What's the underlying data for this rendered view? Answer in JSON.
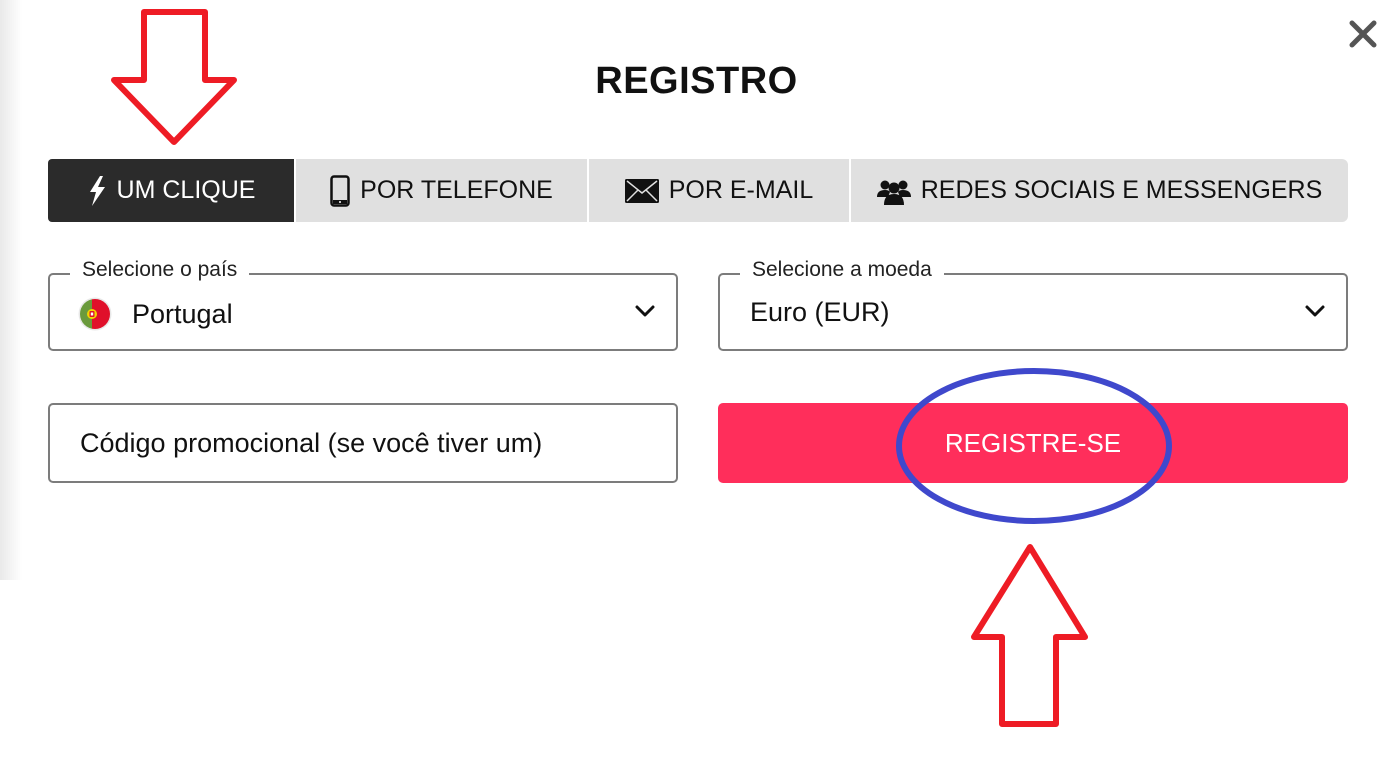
{
  "dialog": {
    "title": "REGISTRO",
    "close_icon": "close-icon"
  },
  "tabs": [
    {
      "label": "UM CLIQUE",
      "icon": "lightning-icon",
      "active": true
    },
    {
      "label": "POR TELEFONE",
      "icon": "mobile-phone-icon",
      "active": false
    },
    {
      "label": "POR E-MAIL",
      "icon": "envelope-icon",
      "active": false
    },
    {
      "label": "REDES SOCIAIS E MESSENGERS",
      "icon": "users-icon",
      "active": false
    }
  ],
  "form": {
    "country": {
      "label": "Selecione o país",
      "value": "Portugal",
      "flag": "portugal-flag-icon"
    },
    "currency": {
      "label": "Selecione a moeda",
      "value": "Euro (EUR)"
    },
    "promo_code": {
      "placeholder": "Código promocional (se você tiver um)",
      "value": ""
    },
    "submit_label": "REGISTRE-SE"
  },
  "annotations": {
    "arrow_color": "#ee1c25",
    "ellipse_color": "#3f48cc"
  },
  "colors": {
    "active_tab": "#2b2b2b",
    "inactive_tab": "#e0e0e0",
    "primary_button": "#ff2e5b"
  }
}
